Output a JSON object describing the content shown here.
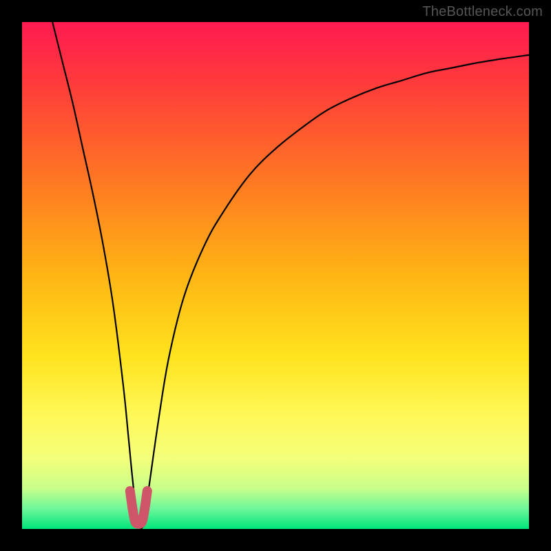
{
  "watermark": "TheBottleneck.com",
  "chart_data": {
    "type": "line",
    "title": "",
    "xlabel": "",
    "ylabel": "",
    "xlim": [
      0,
      100
    ],
    "ylim": [
      0,
      100
    ],
    "series": [
      {
        "name": "bottleneck-curve",
        "x": [
          6,
          8,
          10,
          12,
          14,
          16,
          18,
          20,
          21,
          22,
          23,
          24,
          25,
          27,
          29,
          32,
          36,
          40,
          45,
          50,
          55,
          60,
          65,
          70,
          75,
          80,
          85,
          90,
          95,
          100
        ],
        "values": [
          100,
          92,
          84,
          75,
          66,
          56,
          44,
          28,
          18,
          8,
          1,
          1,
          8,
          22,
          34,
          46,
          56,
          63,
          70,
          75,
          79,
          82.5,
          85,
          87,
          88.5,
          90,
          91,
          92,
          92.8,
          93.5
        ]
      }
    ],
    "marker": {
      "name": "valley-marker",
      "x": [
        21.3,
        21.8,
        22.3,
        23.0,
        23.7,
        24.2,
        24.7
      ],
      "values": [
        7.5,
        4.0,
        1.5,
        1.0,
        1.5,
        4.0,
        7.5
      ],
      "color": "#cf5668"
    },
    "background": {
      "type": "vertical-gradient",
      "stops": [
        {
          "offset": 0.0,
          "color": "#ff1a51"
        },
        {
          "offset": 0.12,
          "color": "#ff3b3b"
        },
        {
          "offset": 0.32,
          "color": "#ff7a22"
        },
        {
          "offset": 0.5,
          "color": "#ffb514"
        },
        {
          "offset": 0.66,
          "color": "#ffe31e"
        },
        {
          "offset": 0.78,
          "color": "#fff95a"
        },
        {
          "offset": 0.86,
          "color": "#f4ff7a"
        },
        {
          "offset": 0.92,
          "color": "#c9ff8a"
        },
        {
          "offset": 0.96,
          "color": "#6df79a"
        },
        {
          "offset": 1.0,
          "color": "#00e57a"
        }
      ]
    }
  }
}
